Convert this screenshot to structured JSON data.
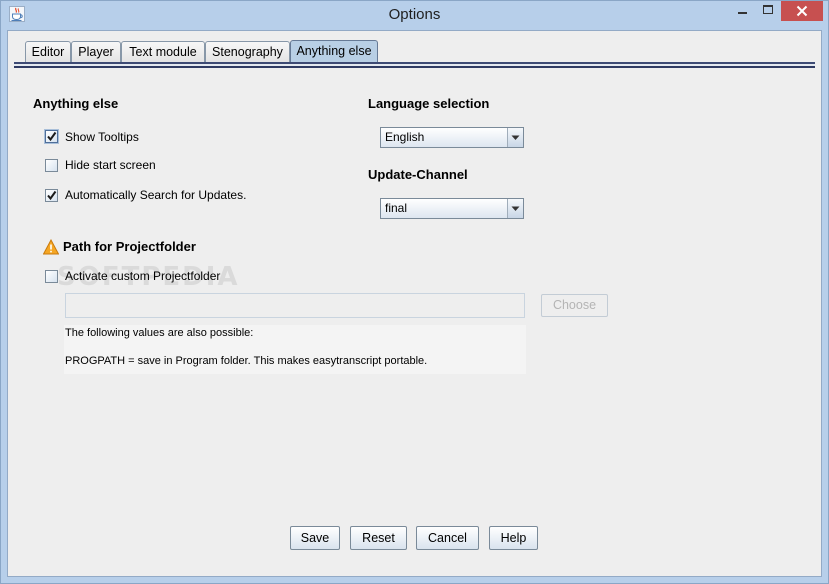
{
  "window": {
    "title": "Options",
    "icon": "java-cup-icon",
    "controls": {
      "minimize": "minimize-icon",
      "maximize": "maximize-icon",
      "close": "close-icon"
    }
  },
  "tabs": [
    {
      "label": "Editor",
      "selected": false
    },
    {
      "label": "Player",
      "selected": false
    },
    {
      "label": "Text module",
      "selected": false
    },
    {
      "label": "Stenography",
      "selected": false
    },
    {
      "label": "Anything else",
      "selected": true
    }
  ],
  "general": {
    "heading": "Anything else",
    "options": [
      {
        "label": "Show Tooltips",
        "checked": true,
        "focused": true
      },
      {
        "label": "Hide start screen",
        "checked": false
      },
      {
        "label": "Automatically Search for Updates.",
        "checked": true
      }
    ]
  },
  "project_folder": {
    "heading": "Path for Projectfolder",
    "heading_icon": "warning-icon",
    "custom_option": {
      "label": "Activate custom Projectfolder",
      "checked": false
    },
    "path_field": {
      "value": "",
      "disabled": true
    },
    "choose_button": {
      "label": "Choose",
      "disabled": true
    },
    "hint_lines": [
      "The following values are also possible:",
      "PROGPATH = save in Program folder. This makes easytranscript portable."
    ]
  },
  "language": {
    "heading": "Language selection",
    "selected": "English",
    "arrow_icon": "dropdown-arrow-icon"
  },
  "update_channel": {
    "heading": "Update-Channel",
    "selected": "final",
    "arrow_icon": "dropdown-arrow-icon"
  },
  "footer_buttons": {
    "save": "Save",
    "reset": "Reset",
    "cancel": "Cancel",
    "help": "Help"
  },
  "watermark": "SOFTPEDIA",
  "colors": {
    "frame": "#b7cfea",
    "selected_tab": "#b8cfe5",
    "close_button": "#c75050",
    "warning": "#f5a623"
  }
}
